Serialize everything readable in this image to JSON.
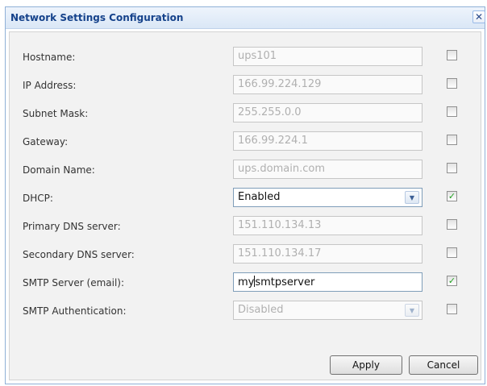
{
  "dialog": {
    "title": "Network Settings Configuration",
    "close_glyph": "✕"
  },
  "fields": [
    {
      "label": "Hostname:",
      "value": "ups101",
      "type": "text",
      "enabled": false,
      "checked": false
    },
    {
      "label": "IP Address:",
      "value": "166.99.224.129",
      "type": "text",
      "enabled": false,
      "checked": false
    },
    {
      "label": "Subnet Mask:",
      "value": "255.255.0.0",
      "type": "text",
      "enabled": false,
      "checked": false
    },
    {
      "label": "Gateway:",
      "value": "166.99.224.1",
      "type": "text",
      "enabled": false,
      "checked": false
    },
    {
      "label": "Domain Name:",
      "value": "ups.domain.com",
      "type": "text",
      "enabled": false,
      "checked": false
    },
    {
      "label": "DHCP:",
      "value": "Enabled",
      "type": "select",
      "enabled": true,
      "checked": true
    },
    {
      "label": "Primary DNS server:",
      "value": "151.110.134.13",
      "type": "text",
      "enabled": false,
      "checked": false
    },
    {
      "label": "Secondary DNS server:",
      "value": "151.110.134.17",
      "type": "text",
      "enabled": false,
      "checked": false
    },
    {
      "label": "SMTP Server (email):",
      "value_before_caret": "my",
      "value_after_caret": "smtpserver",
      "type": "text",
      "enabled": true,
      "checked": true
    },
    {
      "label": "SMTP Authentication:",
      "value": "Disabled",
      "type": "select",
      "enabled": false,
      "checked": false
    }
  ],
  "buttons": {
    "apply": "Apply",
    "cancel": "Cancel"
  },
  "icons": {
    "dropdown": "chevron-down-icon",
    "check": "✓"
  },
  "colors": {
    "title": "#15428b",
    "checkmark": "#21a121",
    "border_accent": "#8fb0d7"
  }
}
